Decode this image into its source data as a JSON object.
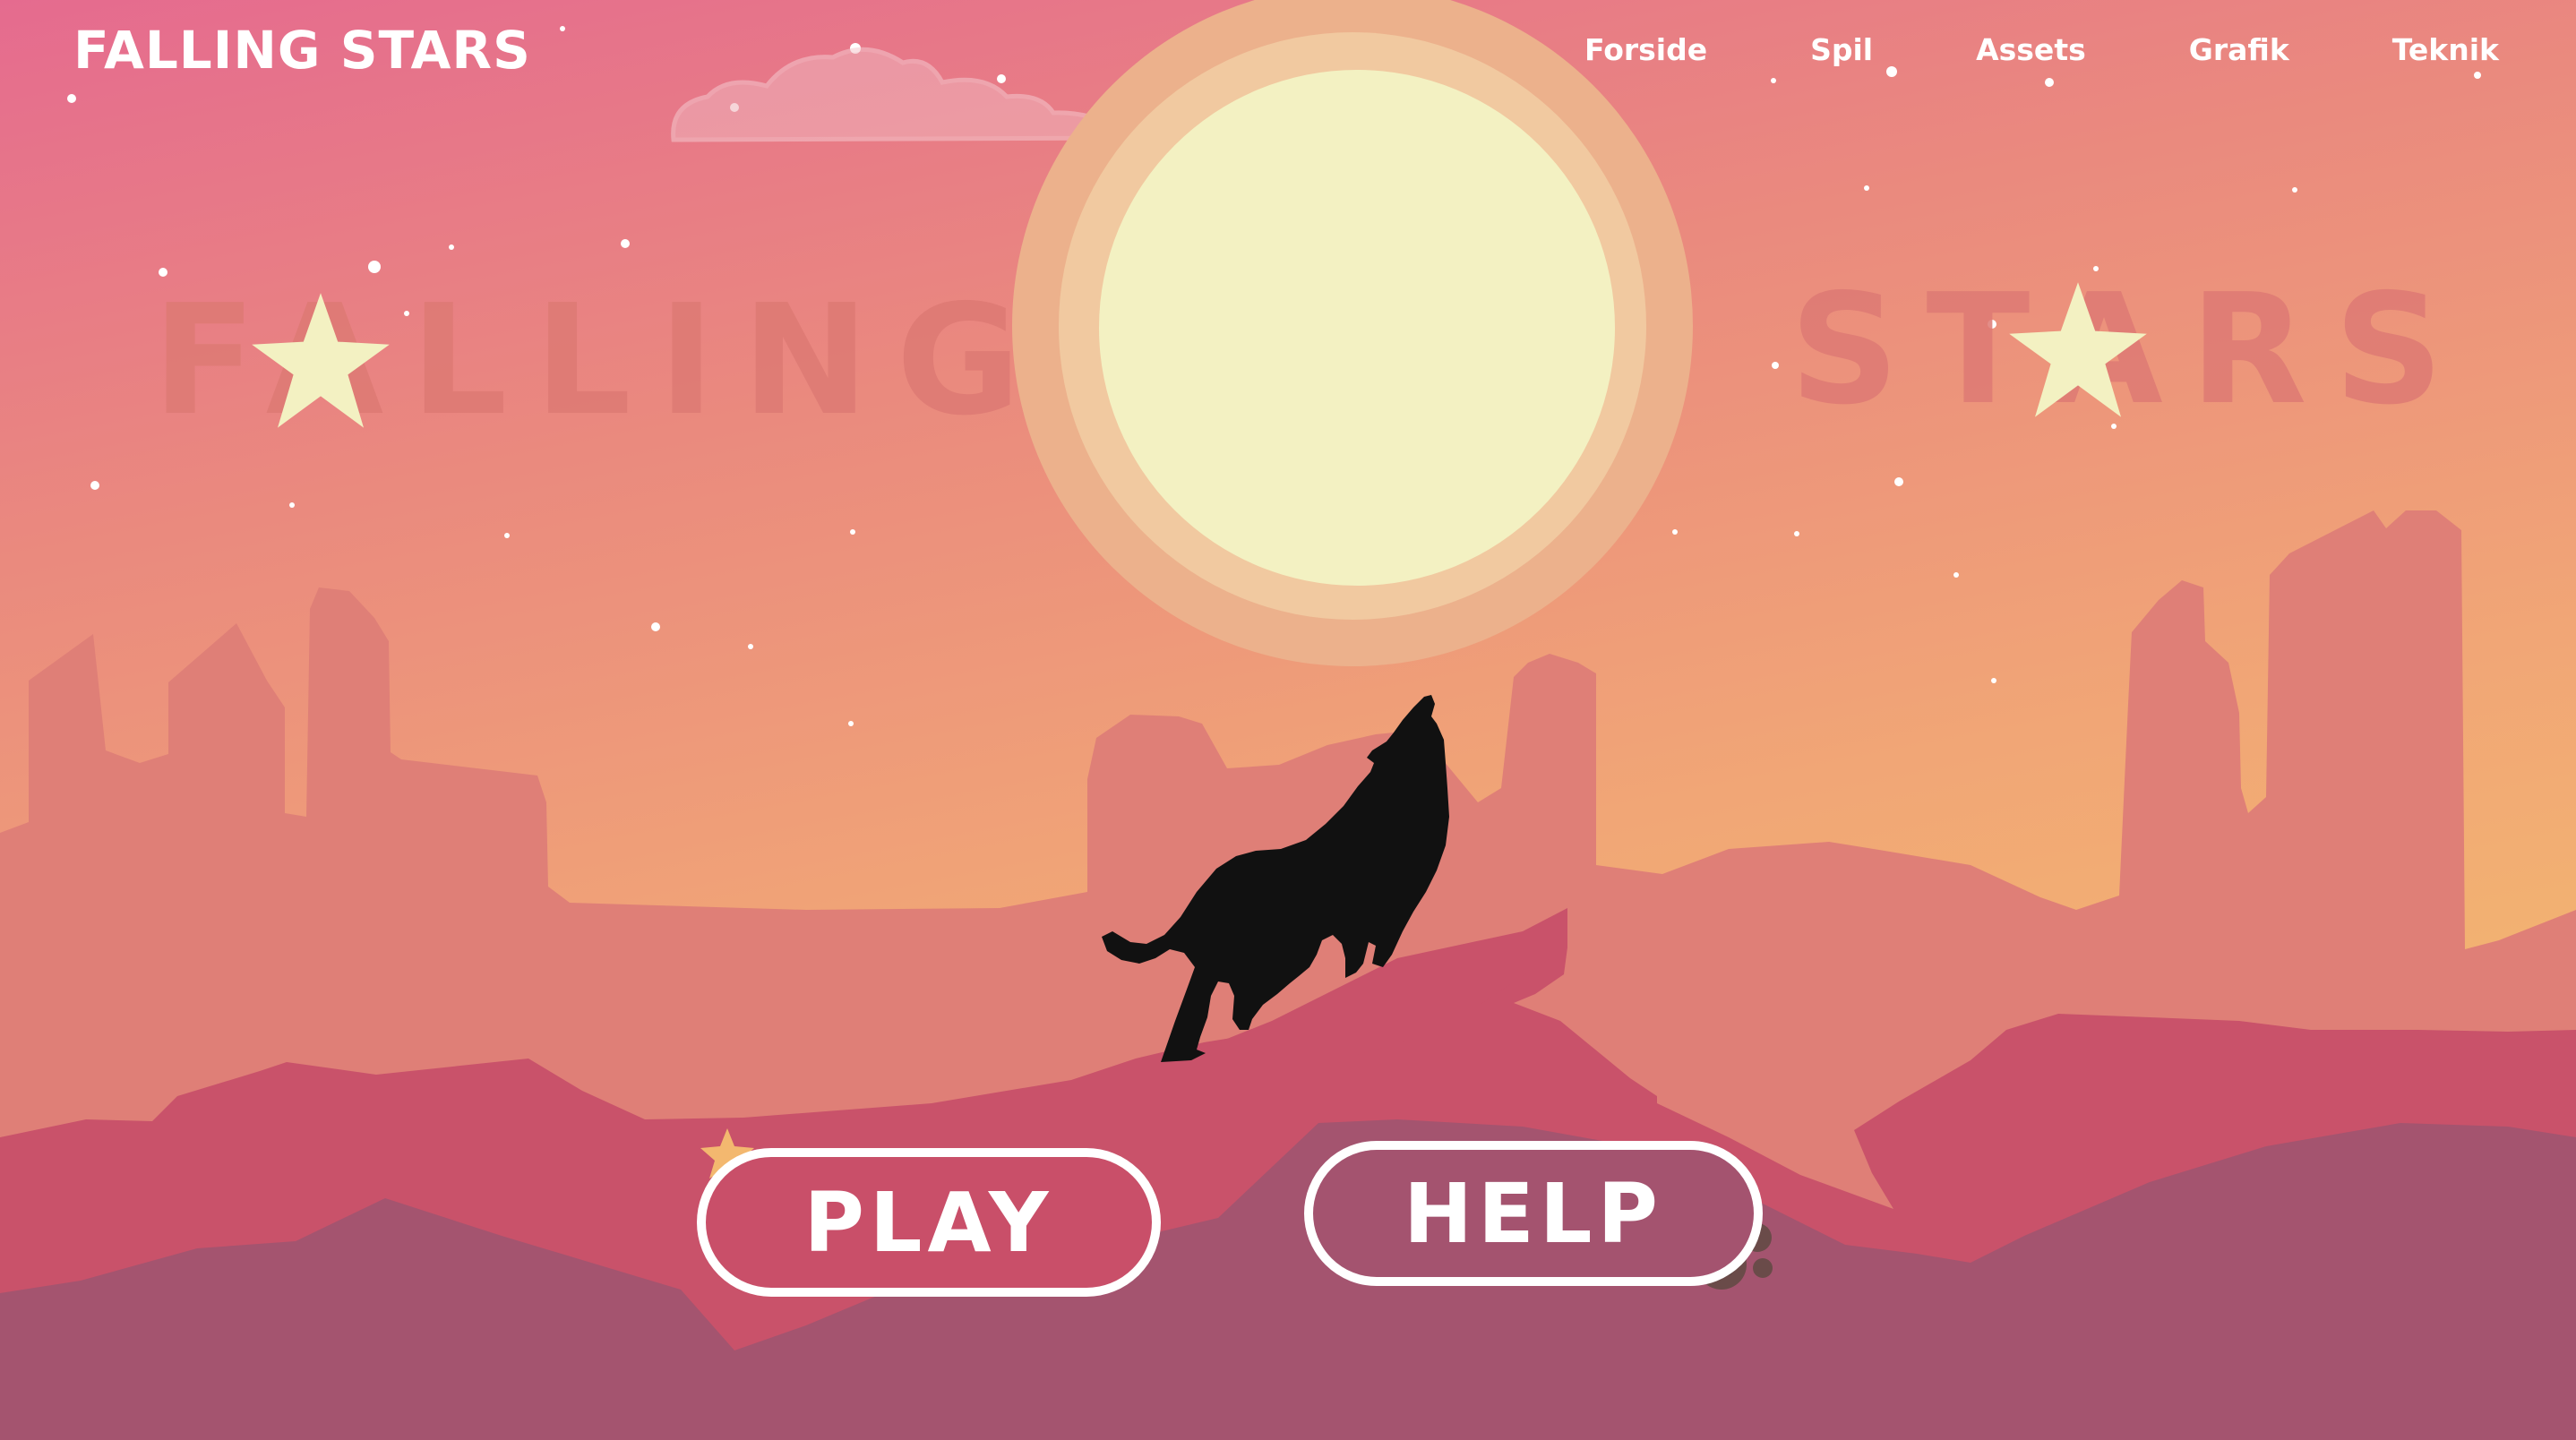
{
  "site": {
    "logo_text": "FALLING STARS"
  },
  "nav": {
    "items": [
      {
        "label": "Forside"
      },
      {
        "label": "Spil"
      },
      {
        "label": "Assets"
      },
      {
        "label": "Grafik"
      },
      {
        "label": "Teknik"
      }
    ]
  },
  "hero": {
    "title_left": "FALLING",
    "title_right": "STARS"
  },
  "buttons": {
    "play_label": "PLAY",
    "help_label": "HELP"
  },
  "colors": {
    "sky_top": "#e56d8e",
    "sky_bottom": "#f2b170",
    "moon": "#f3f1c2",
    "moon_halo": "#f0c89e",
    "mesa": "#dd7f76",
    "hills_mid": "#c94f69",
    "hills_front": "#a4536f",
    "star": "#f3f1c2",
    "title_watermark": "#de7a74"
  },
  "icons": {
    "title_star": "star-icon",
    "play_stars": "stars-icon",
    "help_meteors": "meteor-icon",
    "cloud": "cloud-icon",
    "wolf": "howling-wolf-silhouette"
  }
}
